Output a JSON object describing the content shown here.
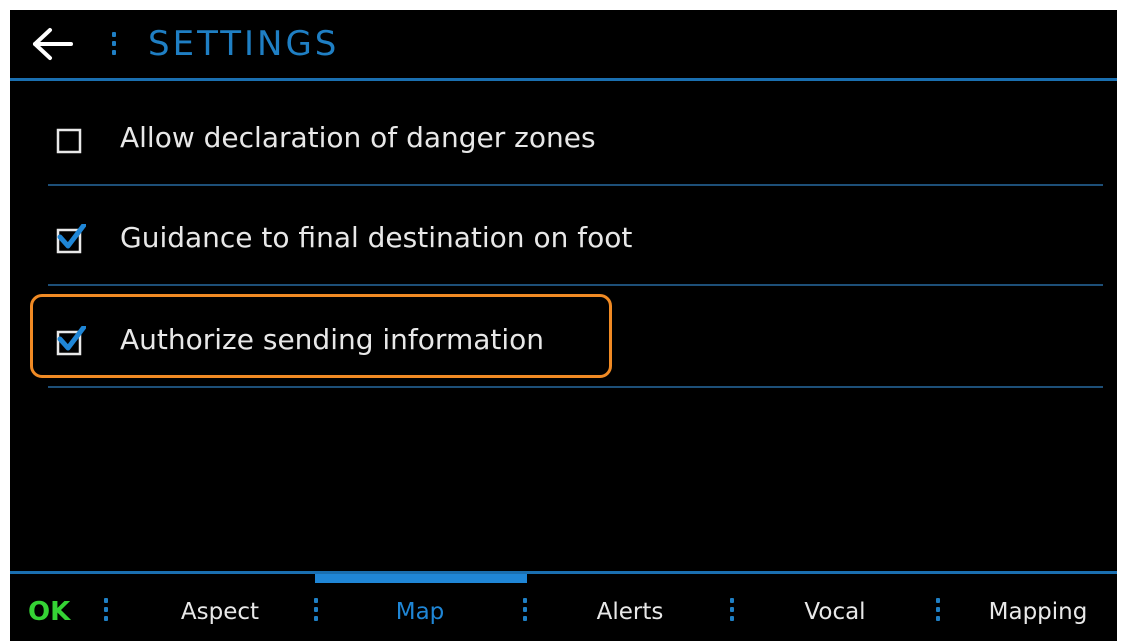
{
  "header": {
    "back_icon": "arrow-left-icon",
    "title": "SETTINGS"
  },
  "options": [
    {
      "label": "Allow declaration of danger zones",
      "checked": false
    },
    {
      "label": "Guidance to final destination on foot",
      "checked": true
    },
    {
      "label": "Authorize sending information",
      "checked": true,
      "highlighted": true
    }
  ],
  "tabbar": {
    "ok_label": "OK",
    "tabs": [
      {
        "label": "Aspect",
        "active": false
      },
      {
        "label": "Map",
        "active": true
      },
      {
        "label": "Alerts",
        "active": false
      },
      {
        "label": "Vocal",
        "active": false
      },
      {
        "label": "Mapping",
        "active": false
      }
    ]
  },
  "colors": {
    "background": "#000000",
    "accent": "#1f86d6",
    "ok": "#35d335",
    "highlight": "#f08a24",
    "text": "#e8e8e8"
  }
}
